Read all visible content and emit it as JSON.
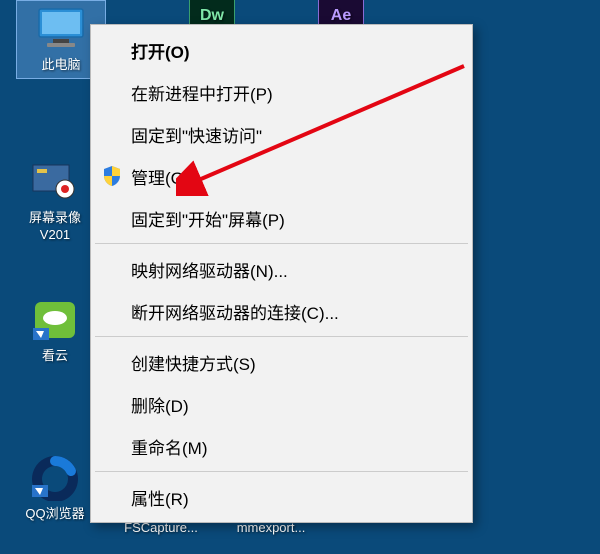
{
  "desktop_icons": {
    "this_pc": {
      "label": "此电脑"
    },
    "screen_rec": {
      "label": "屏幕录像\nV201"
    },
    "kanyun": {
      "label": "看云"
    },
    "qq_browser": {
      "label": "QQ浏览器"
    },
    "dw": {
      "label": "Dw"
    },
    "ae": {
      "label": "Ae"
    },
    "fscapture": {
      "label": "FSCapture..."
    },
    "mmexport": {
      "label": "mmexport..."
    }
  },
  "context_menu": {
    "open": "打开(O)",
    "open_new_process": "在新进程中打开(P)",
    "pin_quick_access": "固定到\"快速访问\"",
    "manage": "管理(G)",
    "pin_start": "固定到\"开始\"屏幕(P)",
    "map_drive": "映射网络驱动器(N)...",
    "disconnect_drive": "断开网络驱动器的连接(C)...",
    "create_shortcut": "创建快捷方式(S)",
    "delete": "删除(D)",
    "rename": "重命名(M)",
    "properties": "属性(R)"
  }
}
